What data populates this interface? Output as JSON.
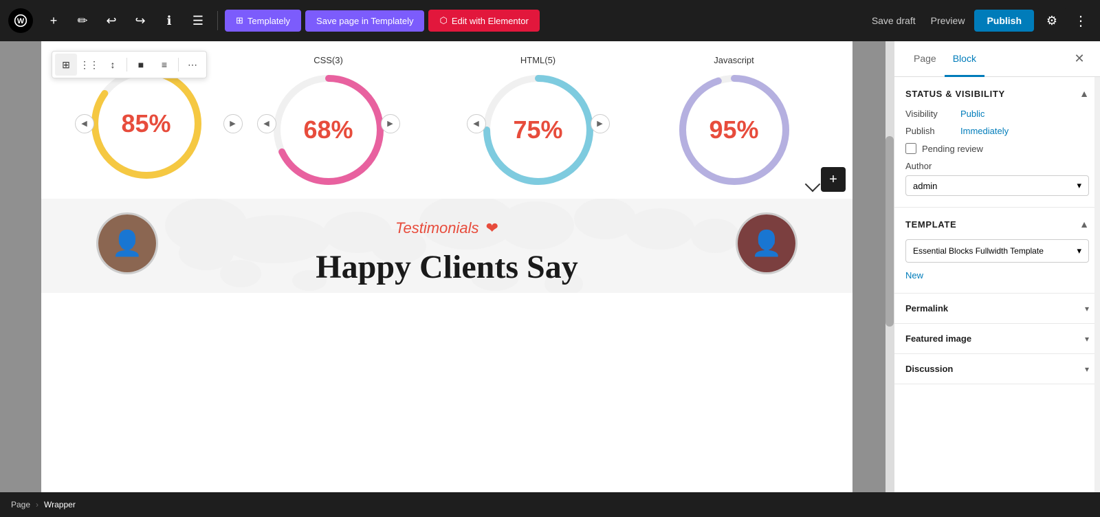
{
  "toolbar": {
    "wp_logo": "W",
    "add_label": "+",
    "edit_label": "✏",
    "undo_label": "↩",
    "redo_label": "↪",
    "info_label": "ℹ",
    "list_label": "☰",
    "templately_label": "Templately",
    "save_templately_label": "Save page in Templately",
    "elementor_label": "Edit with Elementor",
    "save_draft_label": "Save draft",
    "preview_label": "Preview",
    "publish_label": "Publish",
    "settings_label": "⚙",
    "more_label": "⋮"
  },
  "block_toolbar": {
    "icon1": "⊞",
    "icon2": "⋮⋮",
    "icon3": "↕",
    "icon4": "■",
    "icon5": "≡",
    "icon6": "⋯"
  },
  "circles": [
    {
      "label": "",
      "percent": "85%",
      "value": 85,
      "color": "#f5c842",
      "bg": "#f0f0f0"
    },
    {
      "label": "CSS(3)",
      "percent": "68%",
      "value": 68,
      "color": "#e8619f",
      "bg": "#f0f0f0"
    },
    {
      "label": "HTML(5)",
      "percent": "75%",
      "value": 75,
      "color": "#7ecbdf",
      "bg": "#f0f0f0"
    },
    {
      "label": "Javascript",
      "percent": "95%",
      "value": 95,
      "color": "#b5b0e0",
      "bg": "#f0f0f0"
    }
  ],
  "testimonials": {
    "title": "Testimonials",
    "heart": "❤",
    "subtitle": "Happy Clients Say"
  },
  "right_panel": {
    "tab_page": "Page",
    "tab_block": "Block",
    "close_label": "✕",
    "status_visibility": {
      "title": "Status & visibility",
      "visibility_label": "Visibility",
      "visibility_value": "Public",
      "publish_label": "Publish",
      "publish_value": "Immediately",
      "pending_review": "Pending review",
      "author_label": "Author",
      "author_value": "admin",
      "chevron": "▾"
    },
    "template": {
      "title": "Template",
      "value": "Essential Blocks Fullwidth Template",
      "new_label": "New",
      "chevron": "▾"
    },
    "permalink": {
      "title": "Permalink",
      "chevron": "▾"
    },
    "featured_image": {
      "title": "Featured image",
      "chevron": "▾"
    },
    "discussion": {
      "title": "Discussion",
      "chevron": "▾"
    }
  },
  "breadcrumb": {
    "items": [
      "Page",
      "Wrapper"
    ],
    "separator": "›"
  }
}
